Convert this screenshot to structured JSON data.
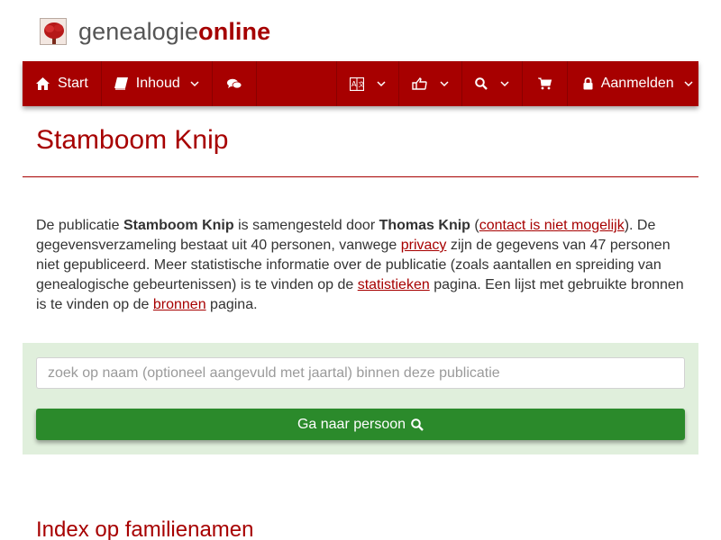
{
  "brand": {
    "part1": "genealogie",
    "part2": "online"
  },
  "nav": {
    "start": "Start",
    "inhoud": "Inhoud",
    "login": "Aanmelden"
  },
  "page": {
    "title": "Stamboom Knip"
  },
  "intro": {
    "t1": "De publicatie ",
    "pub_name": "Stamboom Knip",
    "t2": " is samengesteld door ",
    "author": "Thomas Knip",
    "t3": " (",
    "contact_link": "contact is niet mogelijk",
    "t4": "). De gegevensverzameling bestaat uit 40 personen, vanwege ",
    "privacy_link": "privacy",
    "t5": " zijn de gegevens van 47 personen niet gepubliceerd. Meer statistische informatie over de publicatie (zoals aantallen en spreiding van genealogische gebeurtenissen) is te vinden op de ",
    "stats_link": "statistieken",
    "t6": " pagina. Een lijst met gebruikte bronnen is te vinden op de ",
    "sources_link": "bronnen",
    "t7": " pagina."
  },
  "search": {
    "placeholder": "zoek op naam (optioneel aangevuld met jaartal) binnen deze publicatie",
    "button": "Ga naar persoon"
  },
  "index": {
    "heading": "Index op familienamen"
  },
  "colors": {
    "brand_red": "#a70000",
    "search_green": "#2b8a2b",
    "panel_green": "#e0efdc"
  },
  "icons": [
    "home-icon",
    "book-icon",
    "comments-icon",
    "language-icon",
    "hand-pointer-icon",
    "search-icon",
    "cart-icon",
    "lock-icon",
    "chevron-down-icon"
  ]
}
